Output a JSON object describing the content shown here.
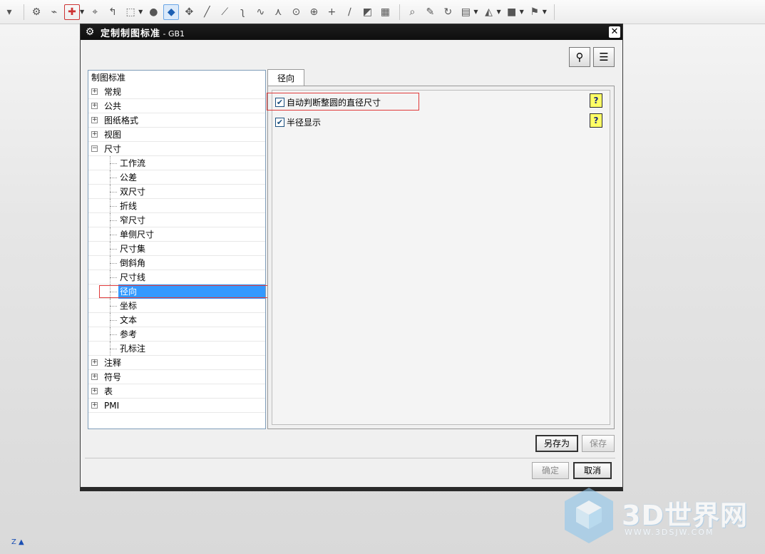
{
  "toolbar": {
    "items": [
      "dropdown-icon",
      "snap-icon",
      "link-icon",
      "select-icon",
      "point-icon",
      "curve-icon",
      "rect-select-icon",
      "shade-icon",
      "view-cube-icon",
      "move-icon",
      "line-icon",
      "line2-icon",
      "arc-icon",
      "spline-icon",
      "fork-icon",
      "circle-icon",
      "target-icon",
      "plus-icon",
      "slash-icon",
      "box-icon",
      "grid-icon",
      "zoom-icon",
      "note-icon",
      "refresh-icon",
      "table-icon",
      "tool-icon",
      "cube-icon",
      "flag-icon"
    ]
  },
  "dialog": {
    "title": "定制制图标准",
    "title_suffix": " - GB1",
    "close_label": "✕",
    "tree": {
      "header": "制图标准",
      "items": [
        {
          "label": "常规",
          "expanded": false
        },
        {
          "label": "公共",
          "expanded": false
        },
        {
          "label": "图纸格式",
          "expanded": false
        },
        {
          "label": "视图",
          "expanded": false
        },
        {
          "label": "尺寸",
          "expanded": true,
          "children": [
            "工作流",
            "公差",
            "双尺寸",
            "折线",
            "窄尺寸",
            "单侧尺寸",
            "尺寸集",
            "倒斜角",
            "尺寸线",
            "径向",
            "坐标",
            "文本",
            "参考",
            "孔标注"
          ]
        },
        {
          "label": "注释",
          "expanded": false
        },
        {
          "label": "符号",
          "expanded": false
        },
        {
          "label": "表",
          "expanded": false
        },
        {
          "label": "PMI",
          "expanded": false
        }
      ],
      "selected": "径向"
    },
    "tab": {
      "label": "径向"
    },
    "options": [
      {
        "label": "自动判断整圆的直径尺寸",
        "checked": true
      },
      {
        "label": "半径显示",
        "checked": true
      }
    ],
    "help_label": "?",
    "buttons": {
      "save_as": "另存为",
      "save": "保存",
      "ok": "确定",
      "cancel": "取消"
    }
  },
  "watermark": {
    "brand": "3D世界网",
    "url": "WWW.3DSJW.COM"
  },
  "axis_label": "Z"
}
